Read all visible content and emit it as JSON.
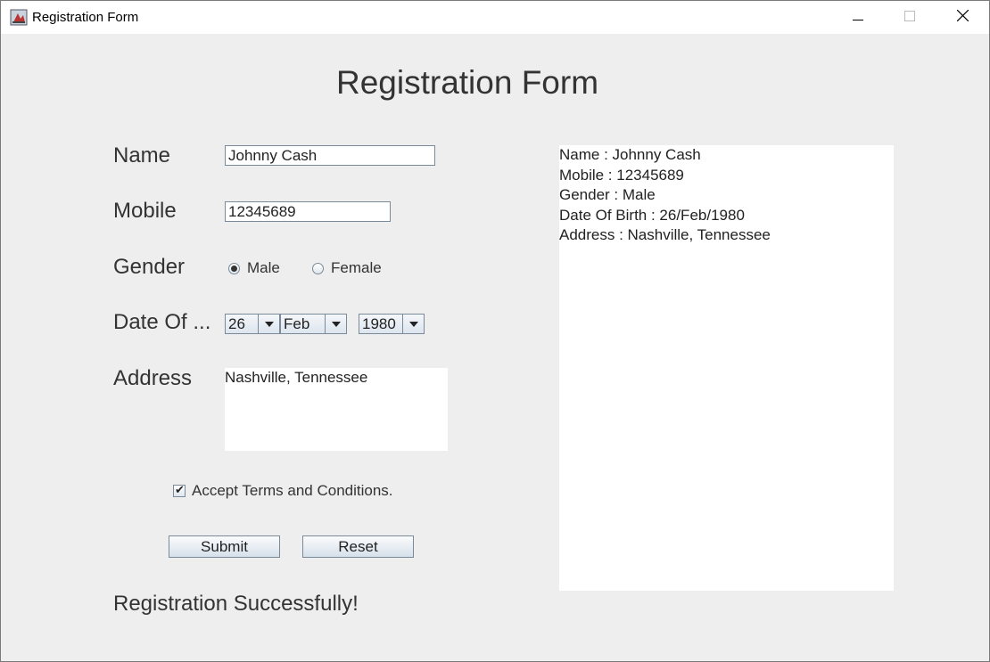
{
  "window": {
    "title": "Registration Form",
    "app_icon": "java-cup-icon",
    "controls": [
      "minimize-icon",
      "maximize-icon",
      "close-icon"
    ]
  },
  "form": {
    "heading": "Registration Form",
    "name": {
      "label": "Name",
      "value": "Johnny Cash"
    },
    "mobile": {
      "label": "Mobile",
      "value": "12345689"
    },
    "gender": {
      "label": "Gender",
      "options": [
        "Male",
        "Female"
      ],
      "selected": "Male"
    },
    "dob": {
      "label": "Date Of ...",
      "day": "26",
      "month": "Feb",
      "year": "1980"
    },
    "address": {
      "label": "Address",
      "value": "Nashville, Tennessee"
    },
    "terms": {
      "label": "Accept Terms and Conditions.",
      "checked": true
    },
    "buttons": {
      "submit": "Submit",
      "reset": "Reset"
    },
    "status": "Registration Successfully!"
  },
  "output": {
    "lines": [
      "Name : Johnny Cash",
      "Mobile : 12345689",
      "Gender : Male",
      "Date Of Birth : 26/Feb/1980",
      "Address : Nashville, Tennessee"
    ]
  }
}
